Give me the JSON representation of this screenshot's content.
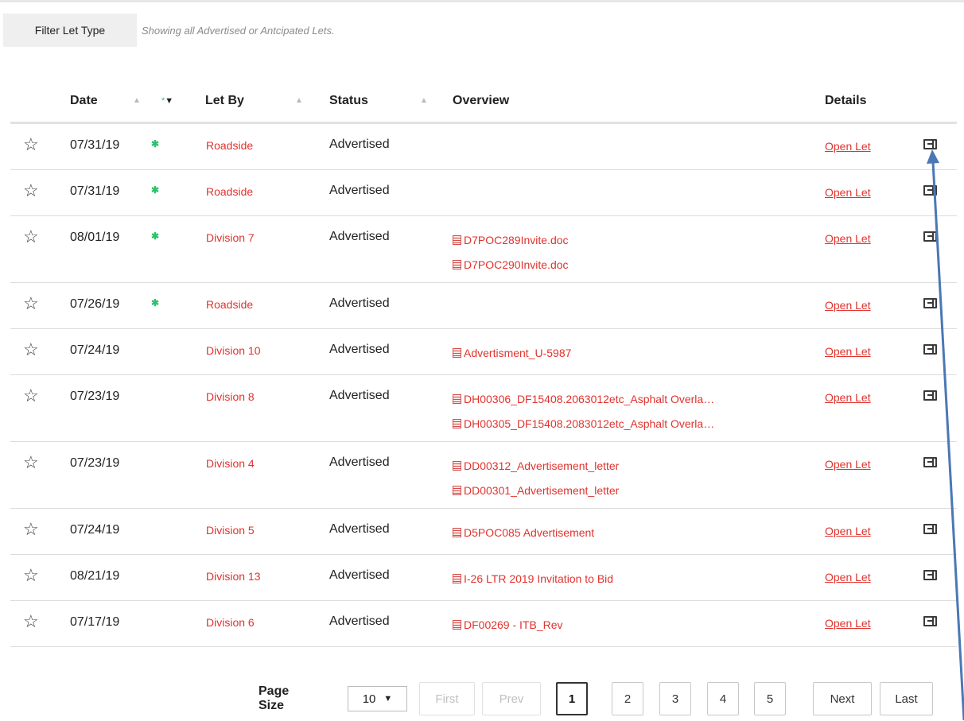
{
  "filter": {
    "button_label": "Filter Let Type",
    "description": "Showing all Advertised or Antcipated Lets."
  },
  "columns": {
    "date": "Date",
    "let_by": "Let By",
    "status": "Status",
    "overview": "Overview",
    "details": "Details"
  },
  "rows": [
    {
      "date": "07/31/19",
      "new": true,
      "let_by": "Roadside",
      "status": "Advertised",
      "docs": [],
      "details_link": "Open Let"
    },
    {
      "date": "07/31/19",
      "new": true,
      "let_by": "Roadside",
      "status": "Advertised",
      "docs": [],
      "details_link": "Open Let"
    },
    {
      "date": "08/01/19",
      "new": true,
      "let_by": "Division 7",
      "status": "Advertised",
      "docs": [
        "D7POC289Invite.doc",
        "D7POC290Invite.doc"
      ],
      "details_link": "Open Let"
    },
    {
      "date": "07/26/19",
      "new": true,
      "let_by": "Roadside",
      "status": "Advertised",
      "docs": [],
      "details_link": "Open Let"
    },
    {
      "date": "07/24/19",
      "new": false,
      "let_by": "Division 10",
      "status": "Advertised",
      "docs": [
        "Advertisment_U-5987"
      ],
      "details_link": "Open Let"
    },
    {
      "date": "07/23/19",
      "new": false,
      "let_by": "Division 8",
      "status": "Advertised",
      "docs": [
        "DH00306_DF15408.2063012etc_Asphalt Overla…",
        "DH00305_DF15408.2083012etc_Asphalt Overla…"
      ],
      "details_link": "Open Let"
    },
    {
      "date": "07/23/19",
      "new": false,
      "let_by": "Division 4",
      "status": "Advertised",
      "docs": [
        "DD00312_Advertisement_letter",
        "DD00301_Advertisement_letter"
      ],
      "details_link": "Open Let"
    },
    {
      "date": "07/24/19",
      "new": false,
      "let_by": "Division 5",
      "status": "Advertised",
      "docs": [
        "D5POC085 Advertisement"
      ],
      "details_link": "Open Let"
    },
    {
      "date": "08/21/19",
      "new": false,
      "let_by": "Division 13",
      "status": "Advertised",
      "docs": [
        "I-26 LTR 2019 Invitation to Bid"
      ],
      "details_link": "Open Let"
    },
    {
      "date": "07/17/19",
      "new": false,
      "let_by": "Division 6",
      "status": "Advertised",
      "docs": [
        "DF00269 - ITB_Rev"
      ],
      "details_link": "Open Let"
    }
  ],
  "pager": {
    "page_size_label": "Page Size",
    "page_size_value": "10",
    "first": "First",
    "prev": "Prev",
    "pages": [
      "1",
      "2",
      "3",
      "4",
      "5"
    ],
    "current_page": "1",
    "next": "Next",
    "last": "Last"
  },
  "colors": {
    "accent_red": "#e0332e",
    "new_marker_green": "#2ec26a",
    "annotation_arrow": "#4a78b5"
  }
}
